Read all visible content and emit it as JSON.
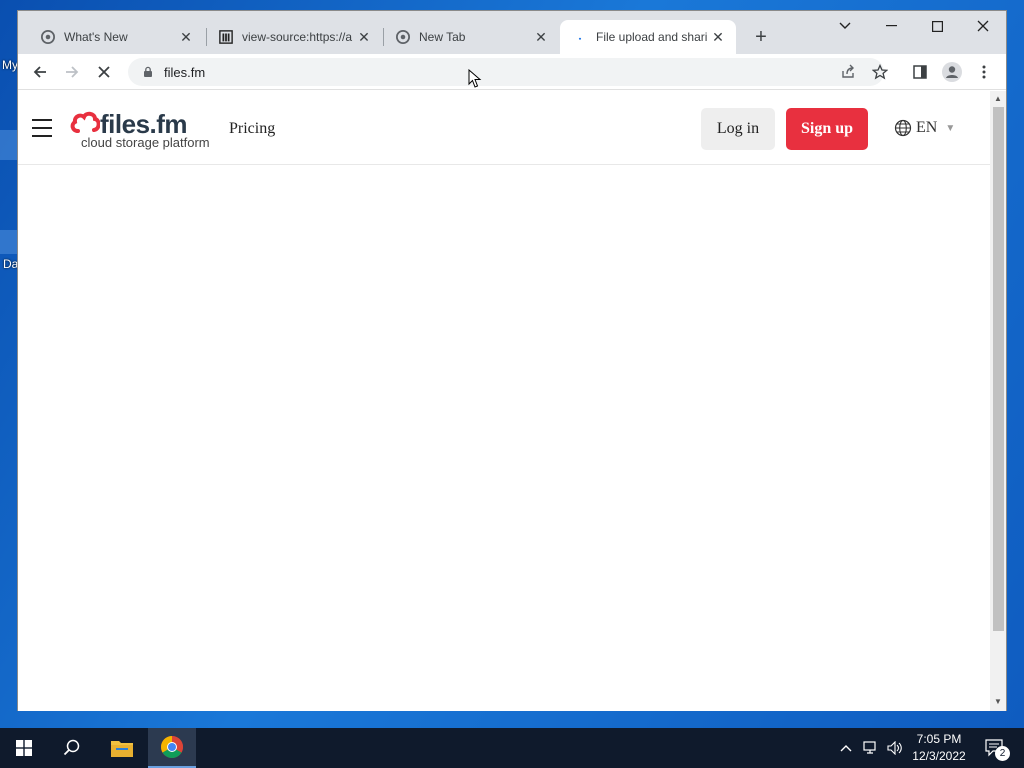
{
  "desktop": {
    "icon_label_1": "My",
    "icon_label_2": "Da"
  },
  "browser": {
    "tabs": [
      {
        "title": "What's New",
        "favicon": "chrome-icon"
      },
      {
        "title": "view-source:https://a",
        "favicon": "library-icon"
      },
      {
        "title": "New Tab",
        "favicon": "chrome-icon"
      },
      {
        "title": "File upload and shari",
        "favicon": "loading-icon",
        "active": true
      }
    ],
    "address": {
      "url": "files.fm"
    }
  },
  "site": {
    "logo_word": "files.fm",
    "logo_tagline": "cloud storage platform",
    "nav_pricing": "Pricing",
    "login_label": "Log in",
    "signup_label": "Sign up",
    "language": "EN",
    "brand_color": "#e8303f"
  },
  "taskbar": {
    "time": "7:05 PM",
    "date": "12/3/2022",
    "notification_count": "2"
  }
}
